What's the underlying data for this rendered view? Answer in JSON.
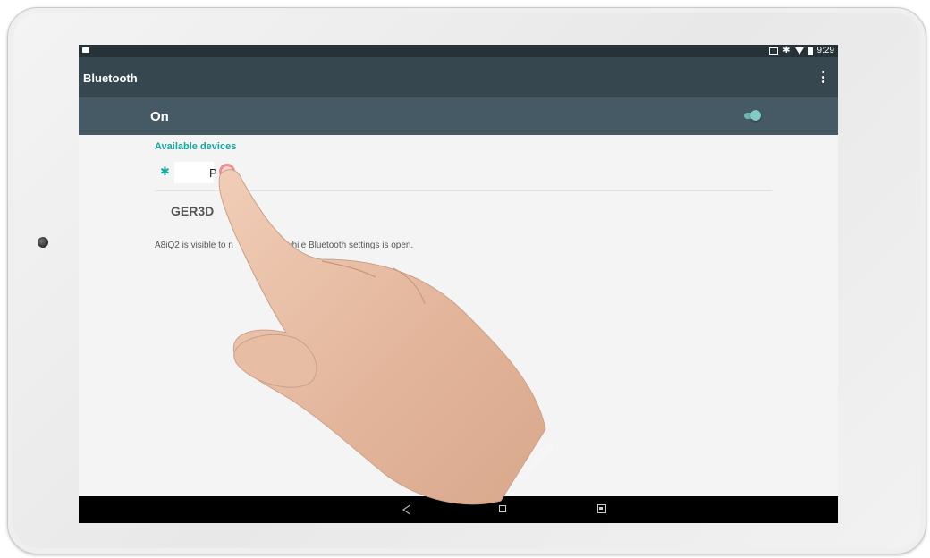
{
  "statusbar": {
    "time": "9:29"
  },
  "appbar": {
    "title": "Bluetooth"
  },
  "toggle": {
    "label": "On",
    "state": "on",
    "accent": "#80cbc4"
  },
  "available_devices": {
    "header": "Available devices",
    "devices": [
      {
        "name_visible": "P",
        "icon": "bluetooth-icon"
      }
    ]
  },
  "second_device": {
    "name": "GER3D"
  },
  "visibility_note": {
    "text_before": "A8iQ2 is visible to n",
    "text_after": "ices while Bluetooth settings is open."
  },
  "colors": {
    "appbar": "#37474f",
    "onbar": "#455a64",
    "accent": "#16a79d",
    "statusbar": "#263238"
  },
  "navbar": {
    "icons": [
      "back-icon",
      "home-icon",
      "recent-apps-icon"
    ]
  }
}
